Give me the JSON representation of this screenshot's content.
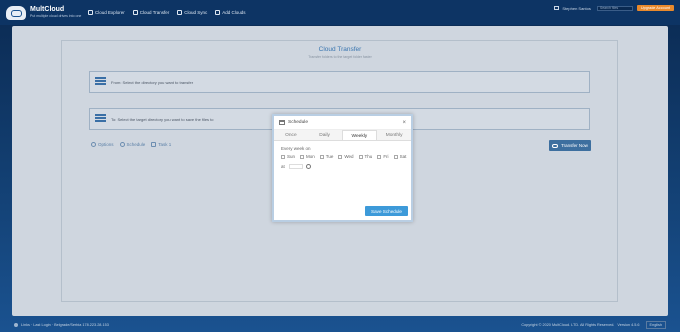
{
  "app": {
    "logo_name": "MultCloud",
    "logo_tagline": "Put multiple cloud drives into one"
  },
  "nav": [
    {
      "label": "Cloud Explorer",
      "icon": "explorer-icon"
    },
    {
      "label": "Cloud Transfer",
      "icon": "transfer-icon"
    },
    {
      "label": "Cloud Sync",
      "icon": "sync-icon"
    },
    {
      "label": "Add Clouds",
      "icon": "add-cloud-icon"
    }
  ],
  "header": {
    "user_label": "Stephen Santos",
    "search_placeholder": "Search files",
    "upgrade_label": "Upgrade Account"
  },
  "page": {
    "title": "Cloud Transfer",
    "subtitle": "Transfer folders to the target folder faster",
    "from_text": "From: Select the directory you want to transfer",
    "to_text": "To: Select the target directory you want to save the files to",
    "options_label": "Options",
    "schedule_label": "Schedule",
    "task_label": "Task 1",
    "transfer_button": "Transfer Now"
  },
  "dialog": {
    "title": "Schedule",
    "close": "×",
    "tabs": [
      "Once",
      "Daily",
      "Weekly",
      "Monthly"
    ],
    "active_tab": "Weekly",
    "every_label": "Every week on",
    "days": [
      "Sun",
      "Mon",
      "Tue",
      "Wed",
      "Thu",
      "Fri",
      "Sat"
    ],
    "at_label": "at",
    "save_button": "Save Schedule"
  },
  "footer": {
    "left_text": "Links · Last Login · Belgrade/Serbia 178.223.28.153",
    "copyright": "Copyright © 2020 MultCloud. LTD. All Rights Reserved.",
    "version": "Version 4.5.6",
    "language": "English"
  },
  "colors": {
    "accent": "#3d9ad9",
    "upgrade": "#e8892c",
    "navbar": "#0d3464"
  }
}
